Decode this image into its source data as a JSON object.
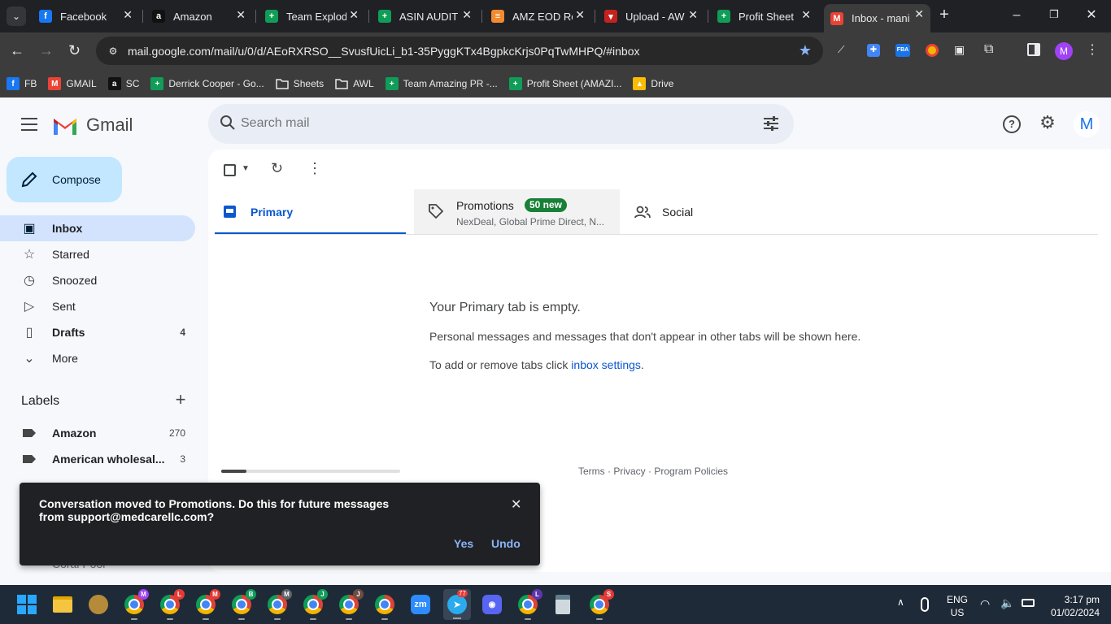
{
  "browser": {
    "tabs": [
      {
        "title": "Facebook",
        "icon": "facebook-icon",
        "color": "#1877f2",
        "glyph": "f"
      },
      {
        "title": "Amazon",
        "icon": "amazon-icon",
        "color": "#111111",
        "glyph": "a"
      },
      {
        "title": "Team Explod",
        "icon": "google-sheets-icon",
        "color": "#0f9d58",
        "glyph": "+"
      },
      {
        "title": "ASIN AUDIT",
        "icon": "google-sheets-icon",
        "color": "#0f9d58",
        "glyph": "+"
      },
      {
        "title": "AMZ EOD Re",
        "icon": "colorful-app-icon",
        "color": "#f28b30",
        "glyph": "≡"
      },
      {
        "title": "Upload - AW",
        "icon": "upload-app-icon",
        "color": "#c5221f",
        "glyph": "▾"
      },
      {
        "title": "Profit Sheet",
        "icon": "google-sheets-icon",
        "color": "#0f9d58",
        "glyph": "+"
      },
      {
        "title": "Inbox - mani",
        "icon": "gmail-icon",
        "color": "#ea4335",
        "glyph": "M",
        "active": true
      }
    ],
    "url": "mail.google.com/mail/u/0/d/AEoRXRSO__SvusfUicLi_b1-35PyggKTx4BgpkcKrjs0PqTwMHPQ/#inbox",
    "profile_initial": "M",
    "bookmarks": [
      {
        "label": "FB",
        "icon": "facebook-icon",
        "color": "#1877f2",
        "glyph": "f"
      },
      {
        "label": "GMAIL",
        "icon": "gmail-icon",
        "color": "#ea4335",
        "glyph": "M"
      },
      {
        "label": "SC",
        "icon": "amazon-icon",
        "color": "#111111",
        "glyph": "a"
      },
      {
        "label": "Derrick Cooper - Go...",
        "icon": "google-sheets-icon",
        "color": "#0f9d58",
        "glyph": "+"
      },
      {
        "label": "Sheets",
        "icon": "folder-icon",
        "color": "",
        "glyph": ""
      },
      {
        "label": "AWL",
        "icon": "folder-icon",
        "color": "",
        "glyph": ""
      },
      {
        "label": "Team Amazing PR -...",
        "icon": "google-sheets-icon",
        "color": "#0f9d58",
        "glyph": "+"
      },
      {
        "label": "Profit Sheet (AMAZI...",
        "icon": "google-sheets-icon",
        "color": "#0f9d58",
        "glyph": "+"
      },
      {
        "label": "Drive",
        "icon": "google-drive-icon",
        "color": "#fbbc04",
        "glyph": "▲"
      }
    ]
  },
  "gmail": {
    "logo_text": "Gmail",
    "search_placeholder": "Search mail",
    "avatar_initial": "M",
    "compose_label": "Compose",
    "nav": [
      {
        "label": "Inbox",
        "icon": "inbox-icon",
        "count": "",
        "bold": true,
        "active": true
      },
      {
        "label": "Starred",
        "icon": "star-icon",
        "count": "",
        "bold": false
      },
      {
        "label": "Snoozed",
        "icon": "clock-icon",
        "count": "",
        "bold": false
      },
      {
        "label": "Sent",
        "icon": "send-icon",
        "count": "",
        "bold": false
      },
      {
        "label": "Drafts",
        "icon": "draft-icon",
        "count": "4",
        "bold": true
      },
      {
        "label": "More",
        "icon": "chevron-down-icon",
        "count": "",
        "bold": false
      }
    ],
    "labels_heading": "Labels",
    "labels": [
      {
        "name": "Amazon",
        "count": "270"
      },
      {
        "name": "American wholesal...",
        "count": "3"
      }
    ],
    "tabs": {
      "primary": "Primary",
      "promotions": "Promotions",
      "promotions_badge": "50 new",
      "promotions_senders": "NexDeal, Global Prime Direct, N...",
      "social": "Social"
    },
    "empty": {
      "title": "Your Primary tab is empty.",
      "body": "Personal messages and messages that don't appear in other tabs will be shown here.",
      "settings_prefix": "To add or remove tabs click ",
      "settings_link": "inbox settings",
      "settings_suffix": "."
    },
    "footer": {
      "terms": "Terms",
      "privacy": "Privacy",
      "policies": "Program Policies",
      "sep": " · "
    },
    "snackbar": {
      "message": "Conversation moved to Promotions. Do this for future messages from support@medcarellc.com?",
      "yes": "Yes",
      "undo": "Undo"
    }
  },
  "taskbar": {
    "lang": "ENG",
    "region": "US",
    "time": "3:17 pm",
    "date": "01/02/2024",
    "telegram_badge": "77",
    "pinned_badges": [
      "M",
      "L",
      "M",
      "B",
      "M",
      "J",
      "J",
      "",
      "",
      "",
      "",
      "L",
      "",
      "S"
    ]
  }
}
